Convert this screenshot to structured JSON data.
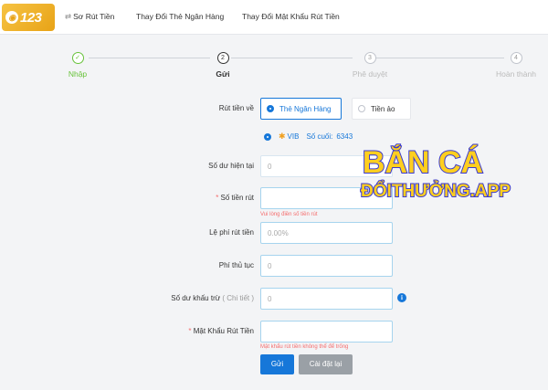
{
  "header": {
    "logo_text": "123",
    "nav": [
      "Sơ Rút Tiền",
      "Thay Đổi Thẻ Ngân Hàng",
      "Thay Đổi Mật Khẩu Rút Tiền"
    ]
  },
  "steps": [
    {
      "num": "✓",
      "label": "Nhập",
      "state": "done"
    },
    {
      "num": "2",
      "label": "Gửi",
      "state": "active"
    },
    {
      "num": "3",
      "label": "Phê duyệt",
      "state": "pending"
    },
    {
      "num": "4",
      "label": "Hoàn thành",
      "state": "pending"
    }
  ],
  "form": {
    "withdraw_to_label": "Rút tiền về",
    "option_bank": "Thẻ Ngân Hàng",
    "option_virtual": "Tiền ảo",
    "bank_name": "VIB",
    "last_digits_label": "Số cuối:",
    "last_digits": "6343",
    "balance_label": "Số dư hiện tại",
    "balance_value": "0",
    "amount_label": "Số tiền rút",
    "amount_error": "Vui lòng điền số tiền rút",
    "fee_rate_label": "Lệ phí rút tiền",
    "fee_rate_value": "0.00%",
    "fee_label": "Phí thủ tục",
    "fee_value": "0",
    "deduct_label": "Số dư khấu trừ",
    "deduct_detail": "( Chi tiết )",
    "deduct_value": "0",
    "password_label": "Mật Khẩu Rút Tiền",
    "password_error": "Mật khẩu rút tiền không thể để trống",
    "submit": "Gửi",
    "reset": "Cài đặt lại"
  },
  "watermark": {
    "line1": "BẮN CÁ",
    "line2": "ĐỔITHƯỞNG.APP"
  },
  "colors": {
    "primary": "#1677d9",
    "success": "#67c23a",
    "error": "#f56c6c"
  }
}
